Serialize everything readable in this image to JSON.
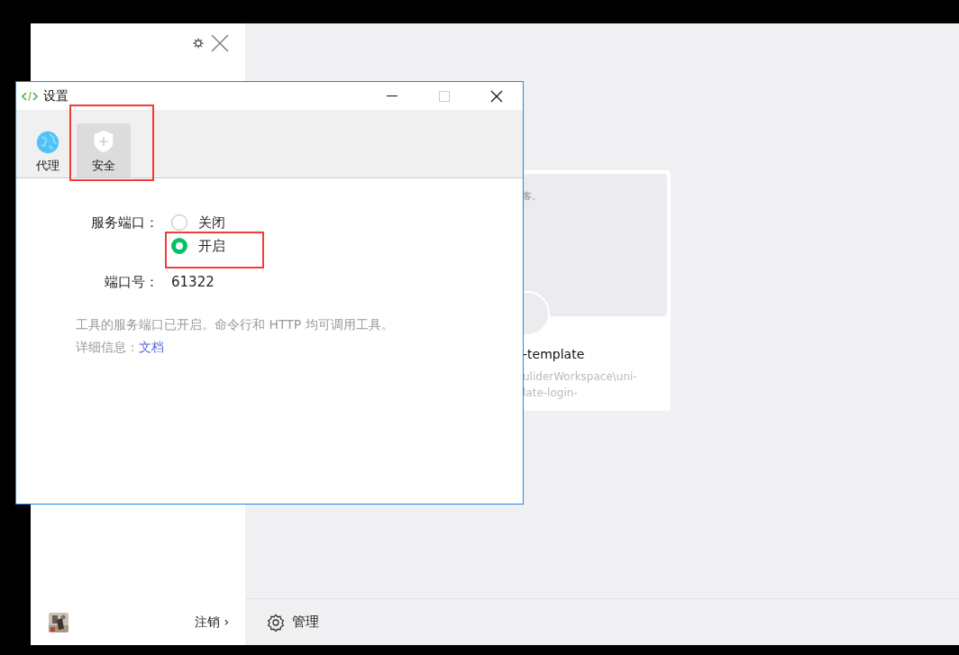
{
  "app": {
    "sidebar": {
      "logout": "注销",
      "chevron": "›"
    },
    "card": {
      "snippet": "客。",
      "title": "-template",
      "path_lines": [
        "uliderWorkspace\\uni-",
        "late-login-"
      ]
    },
    "footer": {
      "manage": "管理"
    }
  },
  "dialog": {
    "title": "设置",
    "tabs": [
      {
        "label": "代理",
        "kind": "globe",
        "selected": false
      },
      {
        "label": "安全",
        "kind": "shield",
        "selected": true
      }
    ],
    "port_service": {
      "label": "服务端口：",
      "options": [
        {
          "label": "关闭",
          "selected": false
        },
        {
          "label": "开启",
          "selected": true
        }
      ]
    },
    "port_number": {
      "label": "端口号：",
      "value": "61322"
    },
    "note": "工具的服务端口已开启。命令行和 HTTP 均可调用工具。详细信息：",
    "link": "文档"
  }
}
